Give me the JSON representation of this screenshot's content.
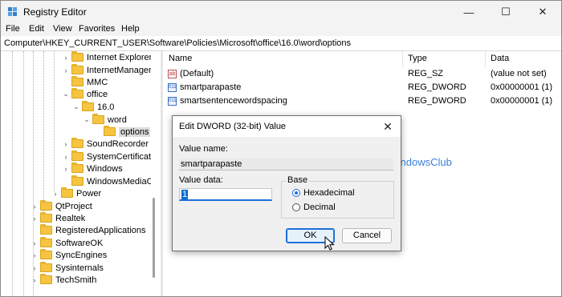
{
  "window": {
    "title": "Registry Editor",
    "controls": {
      "minimize": "—",
      "maximize": "☐",
      "close": "✕"
    }
  },
  "menu": [
    "File",
    "Edit",
    "View",
    "Favorites",
    "Help"
  ],
  "address": "Computer\\HKEY_CURRENT_USER\\Software\\Policies\\Microsoft\\office\\16.0\\word\\options",
  "tree": [
    {
      "label": "Internet Explorer",
      "expander": "›"
    },
    {
      "label": "InternetManager",
      "expander": "›"
    },
    {
      "label": "MMC",
      "expander": ""
    },
    {
      "label": "office",
      "expander": "⌄"
    },
    {
      "label": "16.0",
      "expander": "⌄"
    },
    {
      "label": "word",
      "expander": "⌄"
    },
    {
      "label": "options",
      "expander": "",
      "selected": true
    },
    {
      "label": "SoundRecorder",
      "expander": "›"
    },
    {
      "label": "SystemCertificate",
      "expander": "›"
    },
    {
      "label": "Windows",
      "expander": "›"
    },
    {
      "label": "WindowsMediaC",
      "expander": ""
    },
    {
      "label": "Power",
      "expander": "›"
    },
    {
      "label": "QtProject",
      "expander": "›"
    },
    {
      "label": "Realtek",
      "expander": "›"
    },
    {
      "label": "RegisteredApplications",
      "expander": ""
    },
    {
      "label": "SoftwareOK",
      "expander": "›"
    },
    {
      "label": "SyncEngines",
      "expander": "›"
    },
    {
      "label": "Sysinternals",
      "expander": "›"
    },
    {
      "label": "TechSmith",
      "expander": "›"
    }
  ],
  "columns": {
    "name": "Name",
    "type": "Type",
    "data": "Data"
  },
  "values": [
    {
      "icon": "string-value-icon",
      "glyph": "ab",
      "name": "(Default)",
      "type": "REG_SZ",
      "data": "(value not set)"
    },
    {
      "icon": "binary-value-icon",
      "glyph": "011",
      "name": "smartparapaste",
      "type": "REG_DWORD",
      "data": "0x00000001 (1)"
    },
    {
      "icon": "binary-value-icon",
      "glyph": "011",
      "name": "smartsentencewordspacing",
      "type": "REG_DWORD",
      "data": "0x00000001 (1)"
    }
  ],
  "watermark": "TheWindowsClub",
  "dialog": {
    "title": "Edit DWORD (32-bit) Value",
    "close": "✕",
    "value_name_label": "Value name:",
    "value_name": "smartparapaste",
    "value_data_label": "Value data:",
    "value_data": "1",
    "base_label": "Base",
    "hex_label": "Hexadecimal",
    "dec_label": "Decimal",
    "base_selected": "Hexadecimal",
    "ok": "OK",
    "cancel": "Cancel"
  },
  "colors": {
    "accent": "#1e6fd9",
    "folder": "#f5c542",
    "watermark": "#3a7fd6"
  }
}
